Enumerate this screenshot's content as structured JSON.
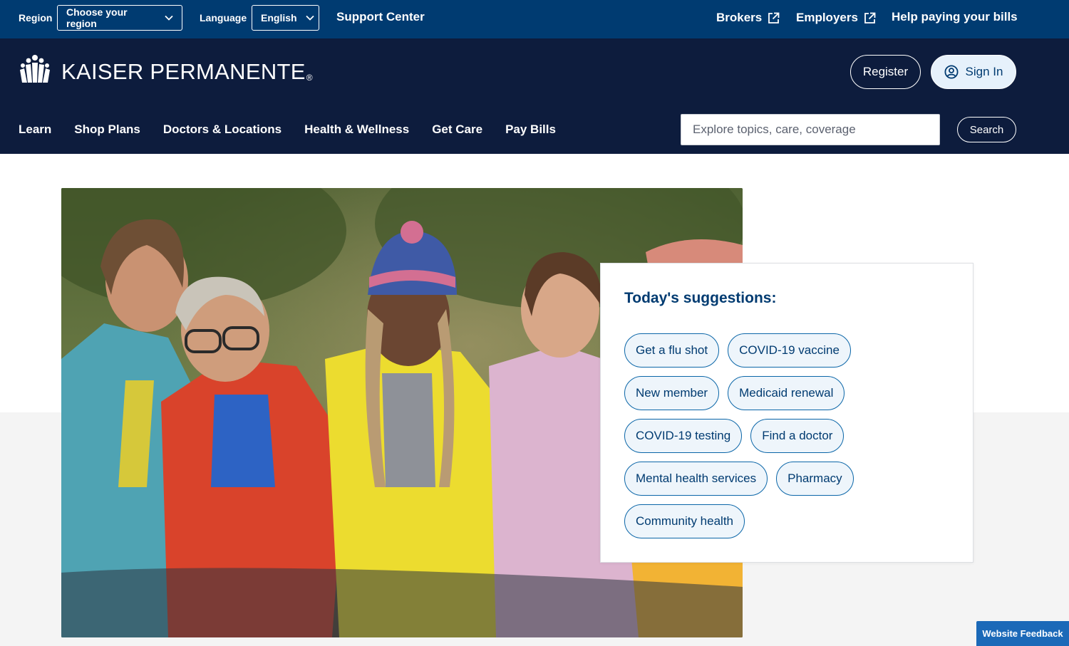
{
  "utility": {
    "region_label": "Region",
    "region_value": "Choose your region",
    "language_label": "Language",
    "language_value": "English",
    "support_center": "Support Center",
    "brokers": "Brokers",
    "employers": "Employers",
    "help_bills": "Help paying your bills"
  },
  "header": {
    "logo_text": "KAISER PERMANENTE",
    "logo_reg": "®",
    "register": "Register",
    "sign_in": "Sign In"
  },
  "nav": {
    "items": [
      "Learn",
      "Shop Plans",
      "Doctors & Locations",
      "Health & Wellness",
      "Get Care",
      "Pay Bills"
    ]
  },
  "search": {
    "placeholder": "Explore topics, care, coverage",
    "button": "Search"
  },
  "suggestions": {
    "title": "Today's suggestions:",
    "chips": [
      "Get a flu shot",
      "COVID-19 vaccine",
      "New member",
      "Medicaid renewal",
      "COVID-19 testing",
      "Find a doctor",
      "Mental health services",
      "Pharmacy",
      "Community health"
    ]
  },
  "feedback": "Website Feedback",
  "colors": {
    "utility_bar": "#003b71",
    "header": "#0d1c3d",
    "accent": "#0b66a8",
    "chip_bg": "#eef5fb",
    "feedback": "#1b69b8"
  },
  "icons": [
    "logo-mark-icon",
    "chevron-down-icon",
    "external-link-icon",
    "user-circle-icon"
  ]
}
